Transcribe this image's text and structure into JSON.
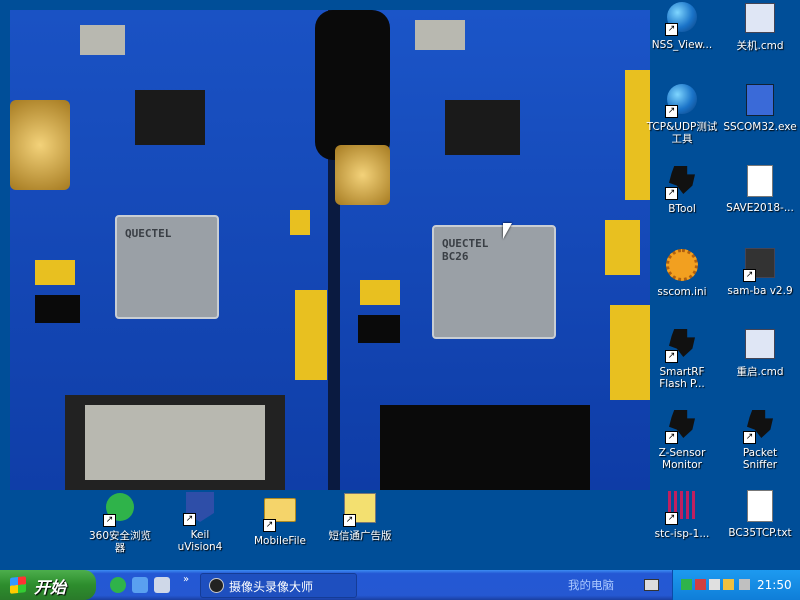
{
  "desktop": {
    "icons_right": [
      {
        "label": "NSS_View...",
        "icon": "globe-icon"
      },
      {
        "label": "关机.cmd",
        "icon": "cmd-icon"
      },
      {
        "label": "TCP&UDP测试\n工具",
        "icon": "network-globe-icon"
      },
      {
        "label": "SSCOM32.exe",
        "icon": "building-icon"
      },
      {
        "label": "BTool",
        "icon": "ti-icon"
      },
      {
        "label": "SAVE2018-...",
        "icon": "document-icon"
      },
      {
        "label": "sscom.ini",
        "icon": "ini-gear-icon"
      },
      {
        "label": "sam-ba v2.9",
        "icon": "chip-icon"
      },
      {
        "label": "SmartRF\nFlash P...",
        "icon": "ti-icon"
      },
      {
        "label": "重启.cmd",
        "icon": "cmd-icon"
      },
      {
        "label": "Z-Sensor\nMonitor",
        "icon": "ti-icon"
      },
      {
        "label": "Packet\nSniffer",
        "icon": "ti-icon"
      },
      {
        "label": "stc-isp-1...",
        "icon": "stc-icon"
      },
      {
        "label": "BC35TCP.txt",
        "icon": "document-icon"
      }
    ],
    "icons_bottom": [
      {
        "label": "360安全浏览\n器",
        "icon": "360-browser-icon"
      },
      {
        "label": "Keil\nuVision4",
        "icon": "keil-icon"
      },
      {
        "label": "MobileFile",
        "icon": "folder-icon"
      },
      {
        "label": "短信通广告版",
        "icon": "sms-icon"
      }
    ]
  },
  "preview": {
    "module_left_label": "QUECTEL",
    "module_right_label": "QUECTEL\nBC26"
  },
  "taskbar": {
    "start_label": "开始",
    "task_label": "摄像头录像大师",
    "address_label": "我的电脑",
    "clock": "21:50"
  }
}
